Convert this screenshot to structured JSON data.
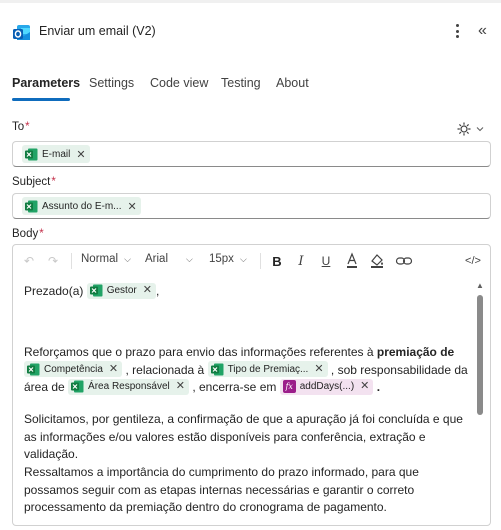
{
  "header": {
    "title": "Enviar um email (V2)"
  },
  "tabs": [
    {
      "label": "Parameters"
    },
    {
      "label": "Settings"
    },
    {
      "label": "Code view"
    },
    {
      "label": "Testing"
    },
    {
      "label": "About"
    }
  ],
  "fields": {
    "to": {
      "label": "To",
      "required": "*",
      "token": "E-mail"
    },
    "subject": {
      "label": "Subject",
      "required": "*",
      "token": "Assunto do E-m..."
    },
    "body": {
      "label": "Body",
      "required": "*"
    }
  },
  "toolbar": {
    "style": "Normal",
    "font": "Arial",
    "size": "15px"
  },
  "body_content": {
    "greeting": "Prezado(a)",
    "greeting_token": "Gestor",
    "greeting_end": ",",
    "p1_a": "Reforçamos que o prazo para envio das informações referentes à ",
    "p1_bold": "premiação de",
    "p1_token1": "Competência",
    "p1_b": ", relacionada à",
    "p1_token2": "Tipo de Premiaç...",
    "p1_c": ", sob responsabilidade da",
    "p1_d": "área de",
    "p1_token3": "Área Responsável",
    "p1_e": ", encerra-se em",
    "p1_token4": "addDays(...)",
    "p1_f": ".",
    "p2": "Solicitamos, por gentileza, a confirmação de que a apuração já foi concluída e que as informações e/ou valores estão disponíveis para conferência, extração e validação.",
    "p3": "Ressaltamos a importância do cumprimento do prazo informado, para que possamos seguir com as etapas internas necessárias e garantir o correto processamento da premiação dentro do cronograma de pagamento."
  },
  "icons": {
    "app": "outlook-icon",
    "excel": "excel-icon",
    "fx": "expression-icon"
  },
  "colors": {
    "accent": "#0f6cbd",
    "required": "#c4314b",
    "excel_token_bg": "#e6f2eb",
    "fx_token_bg": "#f3e2f0"
  }
}
